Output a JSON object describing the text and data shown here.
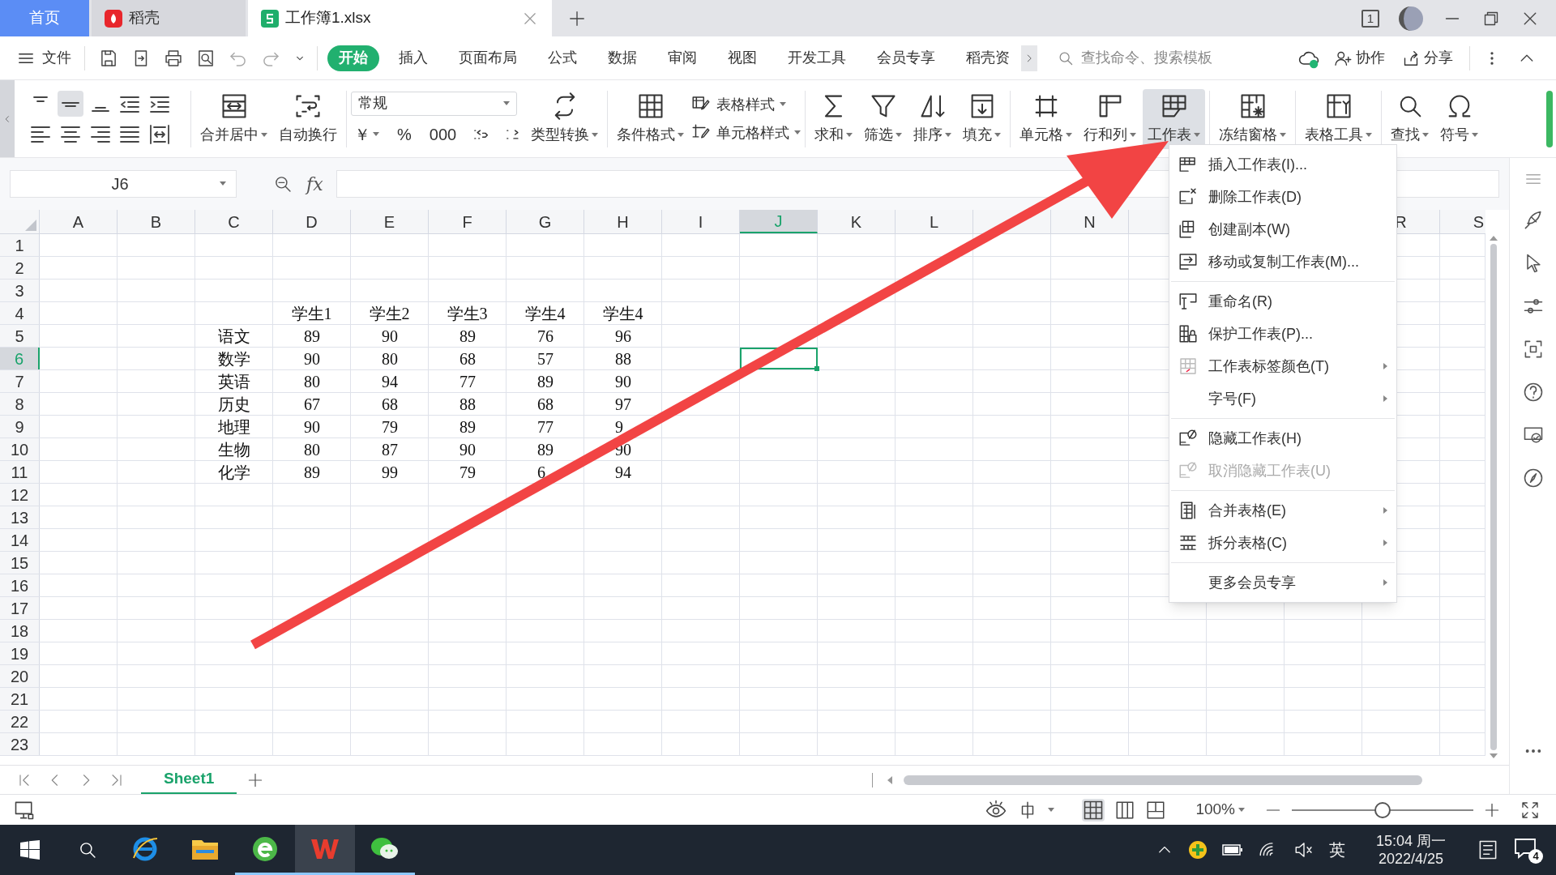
{
  "title_bar": {
    "tabs": [
      {
        "label": "首页",
        "selected": false,
        "kind": "home"
      },
      {
        "label": "稻壳",
        "selected": false,
        "kind": "app"
      },
      {
        "label": "工作簿1.xlsx",
        "selected": true,
        "kind": "doc"
      }
    ],
    "window_count": "1"
  },
  "menu_bar": {
    "file": "文件",
    "tabs": [
      {
        "label": "开始",
        "selected": true
      },
      {
        "label": "插入",
        "selected": false
      },
      {
        "label": "页面布局",
        "selected": false
      },
      {
        "label": "公式",
        "selected": false
      },
      {
        "label": "数据",
        "selected": false
      },
      {
        "label": "审阅",
        "selected": false
      },
      {
        "label": "视图",
        "selected": false
      },
      {
        "label": "开发工具",
        "selected": false
      },
      {
        "label": "会员专享",
        "selected": false
      },
      {
        "label": "稻壳资",
        "selected": false
      }
    ],
    "search": {
      "placeholder": "查找命令、搜索模板"
    },
    "actions": [
      "协作",
      "分享"
    ]
  },
  "ribbon": {
    "groups": [
      {
        "items": [
          {
            "kind": "large",
            "label": "合并居中",
            "dropdown": true,
            "selected": false
          },
          {
            "kind": "large",
            "label": "自动换行",
            "dropdown": false,
            "selected": false
          }
        ]
      },
      {
        "items": [
          {
            "kind": "format",
            "value": "常规"
          },
          {
            "kind": "symbol",
            "label": "￥",
            "dropdown": true
          },
          {
            "kind": "symbol",
            "label": "%",
            "dropdown": false
          },
          {
            "kind": "symbol",
            "label": "000",
            "dropdown": false
          },
          {
            "kind": "decimal-more"
          },
          {
            "kind": "decimal-less"
          },
          {
            "kind": "large",
            "label": "类型转换",
            "dropdown": true,
            "selected": false
          }
        ]
      },
      {
        "items": [
          {
            "kind": "large",
            "label": "条件格式",
            "dropdown": true,
            "selected": false
          },
          {
            "kind": "stack",
            "label": "表格样式",
            "dropdown": true
          },
          {
            "kind": "stack",
            "label": "单元格样式",
            "dropdown": true
          }
        ]
      },
      {
        "items": [
          {
            "kind": "large",
            "label": "求和",
            "dropdown": true,
            "selected": false
          },
          {
            "kind": "large",
            "label": "筛选",
            "dropdown": true,
            "selected": false
          },
          {
            "kind": "large",
            "label": "排序",
            "dropdown": true,
            "selected": false
          },
          {
            "kind": "large",
            "label": "填充",
            "dropdown": true,
            "selected": false
          }
        ]
      },
      {
        "items": [
          {
            "kind": "large",
            "label": "单元格",
            "dropdown": true,
            "selected": false
          },
          {
            "kind": "large",
            "label": "行和列",
            "dropdown": true,
            "selected": false
          },
          {
            "kind": "large",
            "label": "工作表",
            "dropdown": true,
            "selected": true
          }
        ]
      },
      {
        "items": [
          {
            "kind": "large",
            "label": "冻结窗格",
            "dropdown": true,
            "selected": false
          }
        ]
      },
      {
        "items": [
          {
            "kind": "large",
            "label": "表格工具",
            "dropdown": true,
            "selected": false
          }
        ]
      },
      {
        "items": [
          {
            "kind": "large",
            "label": "查找",
            "dropdown": true,
            "selected": false
          },
          {
            "kind": "large",
            "label": "符号",
            "dropdown": true,
            "selected": false
          }
        ]
      }
    ]
  },
  "formula_bar": {
    "name_box": "J6",
    "fx": "fx"
  },
  "sheet": {
    "columns_left": [
      {
        "label": "A",
        "selected": false
      },
      {
        "label": "B",
        "selected": false
      },
      {
        "label": "C",
        "selected": false
      },
      {
        "label": "D",
        "selected": false
      },
      {
        "label": "E",
        "selected": false
      },
      {
        "label": "F",
        "selected": false
      },
      {
        "label": "G",
        "selected": false
      },
      {
        "label": "H",
        "selected": false
      },
      {
        "label": "I",
        "selected": false
      },
      {
        "label": "J",
        "selected": true
      },
      {
        "label": "K",
        "selected": false
      },
      {
        "label": "L",
        "selected": false
      },
      {
        "selected": false
      },
      {
        "label": "N",
        "selected": false
      }
    ],
    "columns_right": [
      {
        "label": "R",
        "selected": false
      },
      {
        "label": "S",
        "selected": false
      }
    ],
    "rows": [
      {
        "number": "1",
        "selected": false
      },
      {
        "number": "2",
        "selected": false
      },
      {
        "number": "3",
        "selected": false
      },
      {
        "number": "4",
        "selected": false,
        "cells": [
          "学生1",
          "学生2",
          "学生3",
          "学生4",
          "学生4"
        ]
      },
      {
        "number": "5",
        "selected": false,
        "cells": [
          "语文",
          "89",
          "90",
          "89",
          "76",
          "96"
        ]
      },
      {
        "number": "6",
        "selected": true,
        "cells": [
          "数学",
          "90",
          "80",
          "68",
          "57",
          "88"
        ]
      },
      {
        "number": "7",
        "selected": false,
        "cells": [
          "英语",
          "80",
          "94",
          "77",
          "89",
          "90"
        ]
      },
      {
        "number": "8",
        "selected": false,
        "cells": [
          "历史",
          "67",
          "68",
          "88",
          "68",
          "97"
        ]
      },
      {
        "number": "9",
        "selected": false,
        "cells": [
          "地理",
          "90",
          "79",
          "89",
          "77",
          "9"
        ]
      },
      {
        "number": "10",
        "selected": false,
        "cells": [
          "生物",
          "80",
          "87",
          "90",
          "89",
          "90"
        ]
      },
      {
        "number": "11",
        "selected": false,
        "cells": [
          "化学",
          "89",
          "99",
          "79",
          "6",
          "94"
        ]
      },
      {
        "number": "12",
        "selected": false
      },
      {
        "number": "13",
        "selected": false
      },
      {
        "number": "14",
        "selected": false
      },
      {
        "number": "15",
        "selected": false
      },
      {
        "number": "16",
        "selected": false
      },
      {
        "number": "17",
        "selected": false
      },
      {
        "number": "18",
        "selected": false
      },
      {
        "number": "19",
        "selected": false
      },
      {
        "number": "20",
        "selected": false
      },
      {
        "number": "21",
        "selected": false
      },
      {
        "number": "22",
        "selected": false
      },
      {
        "number": "23",
        "selected": false
      }
    ]
  },
  "context_menu": {
    "items": [
      {
        "kind": "item",
        "label": "插入工作表(I)...",
        "disabled": false,
        "submenu": false
      },
      {
        "kind": "item",
        "label": "删除工作表(D)",
        "disabled": false,
        "submenu": false
      },
      {
        "kind": "item",
        "label": "创建副本(W)",
        "disabled": false,
        "submenu": false
      },
      {
        "kind": "item",
        "label": "移动或复制工作表(M)...",
        "disabled": false,
        "submenu": false
      },
      {
        "kind": "separator"
      },
      {
        "kind": "item",
        "label": "重命名(R)",
        "disabled": false,
        "submenu": false
      },
      {
        "kind": "item",
        "label": "保护工作表(P)...",
        "disabled": false,
        "submenu": false
      },
      {
        "kind": "item",
        "label": "工作表标签颜色(T)",
        "disabled": false,
        "submenu": true
      },
      {
        "kind": "item",
        "label": "字号(F)",
        "disabled": false,
        "submenu": true
      },
      {
        "kind": "separator"
      },
      {
        "kind": "item",
        "label": "隐藏工作表(H)",
        "disabled": false,
        "submenu": false
      },
      {
        "kind": "item",
        "label": "取消隐藏工作表(U)",
        "disabled": true,
        "submenu": false
      },
      {
        "kind": "separator"
      },
      {
        "kind": "item",
        "label": "合并表格(E)",
        "disabled": false,
        "submenu": true
      },
      {
        "kind": "item",
        "label": "拆分表格(C)",
        "disabled": false,
        "submenu": true
      },
      {
        "kind": "separator"
      },
      {
        "kind": "item",
        "label": "更多会员专享",
        "disabled": false,
        "submenu": true
      }
    ]
  },
  "sheet_tabs": [
    {
      "label": "Sheet1",
      "selected": true
    }
  ],
  "status_bar": {
    "zoom": "100%",
    "zoom_slider": {
      "level": 0.5
    }
  },
  "taskbar": {
    "apps": [
      {
        "kind": "browser-ie",
        "active": false,
        "running": false
      },
      {
        "kind": "folder",
        "active": false,
        "running": false
      },
      {
        "kind": "browser-green",
        "active": false,
        "running": true
      },
      {
        "kind": "office",
        "active": true,
        "running": true
      },
      {
        "kind": "chat",
        "active": false,
        "running": true
      }
    ],
    "input_method": "英",
    "time": "15:04 周一",
    "date": "2022/4/25",
    "notifications": "4"
  }
}
